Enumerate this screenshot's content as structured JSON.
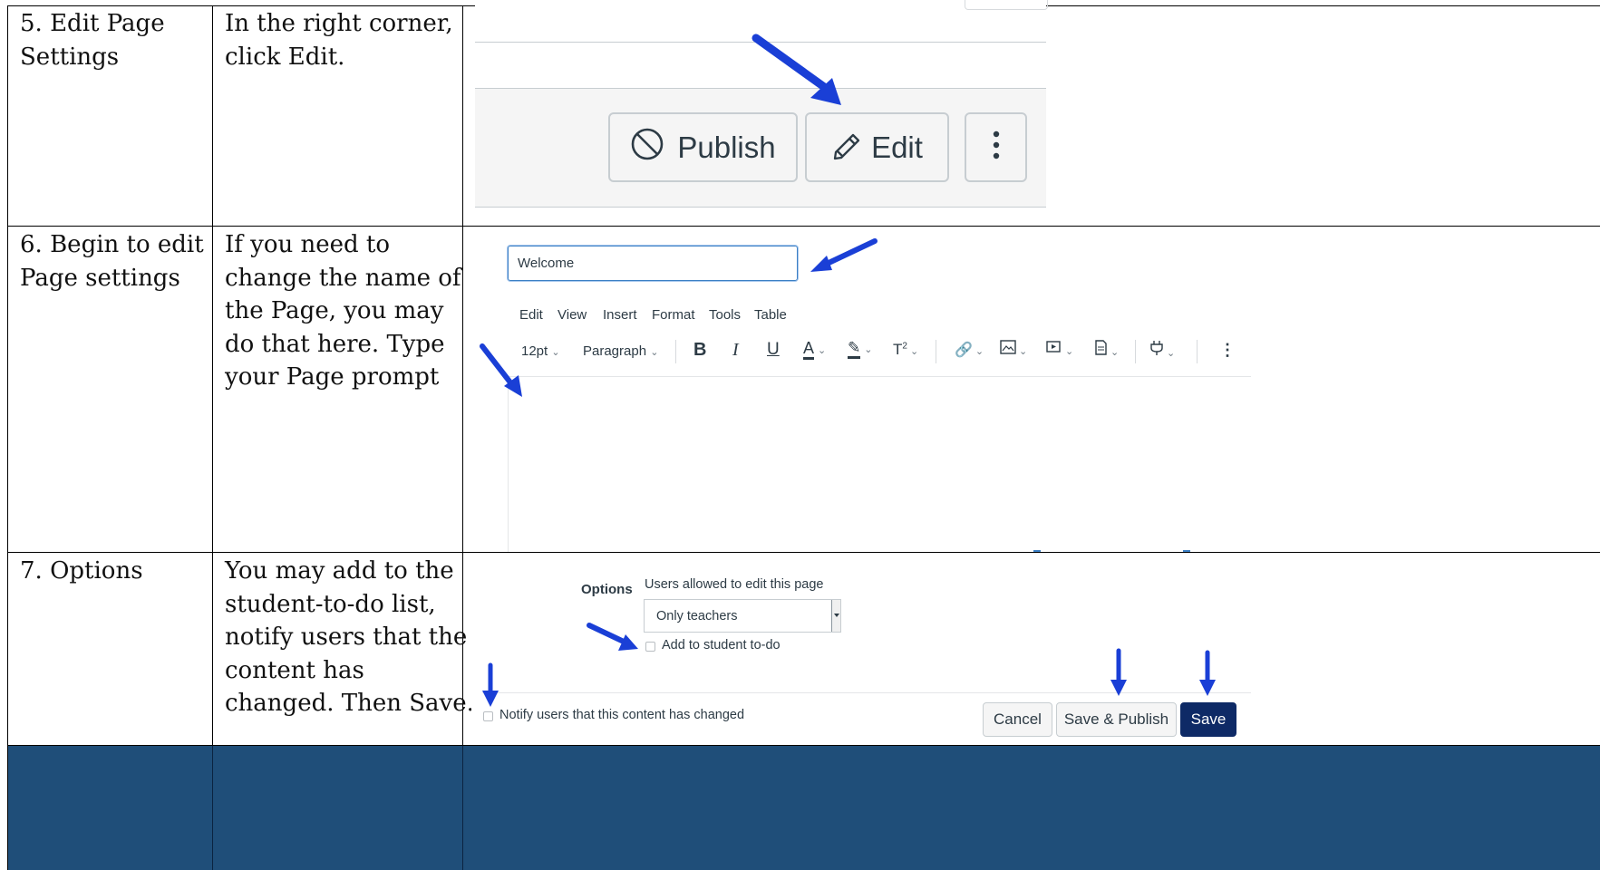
{
  "steps": [
    {
      "title": "5. Edit Page Settings",
      "title_lines": [
        "5. Edit Page",
        "Settings"
      ],
      "desc_lines": [
        "In the right corner,",
        "click Edit."
      ]
    },
    {
      "title": "6. Begin to edit Page settings",
      "title_lines": [
        "6. Begin to edit",
        "Page settings"
      ],
      "desc_lines": [
        "If you need to",
        "change the name of",
        "the Page, you may",
        "do that here. Type",
        "your Page prompt"
      ]
    },
    {
      "title": "7. Options",
      "title_lines": [
        "7. Options"
      ],
      "desc_lines": [
        "You may add to the",
        "student-to-do list,",
        "notify users that the",
        "content has",
        "changed.  Then Save."
      ]
    }
  ],
  "shot1": {
    "publish_label": "Publish",
    "edit_label": "Edit",
    "more_icon": "kebab-vertical-icon"
  },
  "shot2": {
    "title_value": "Welcome",
    "menu": [
      "Edit",
      "View",
      "Insert",
      "Format",
      "Tools",
      "Table"
    ],
    "font_size": "12pt",
    "block_format": "Paragraph",
    "toolbar_icons": [
      "bold-icon",
      "italic-icon",
      "underline-icon",
      "text-color-icon",
      "highlight-icon",
      "superscript-icon",
      "link-icon",
      "image-icon",
      "media-icon",
      "document-icon",
      "plugin-icon",
      "more-icon"
    ]
  },
  "shot3": {
    "options_label": "Options",
    "edit_permission_label": "Users allowed to edit this page",
    "edit_permission_value": "Only teachers",
    "todo_label": "Add to student to-do",
    "notify_label": "Notify users that this content has changed",
    "cancel_label": "Cancel",
    "save_publish_label": "Save & Publish",
    "save_label": "Save"
  },
  "colors": {
    "arrow": "#1a3fd6",
    "footer_bar": "#1f4e79",
    "save_button": "#0e2a66"
  }
}
